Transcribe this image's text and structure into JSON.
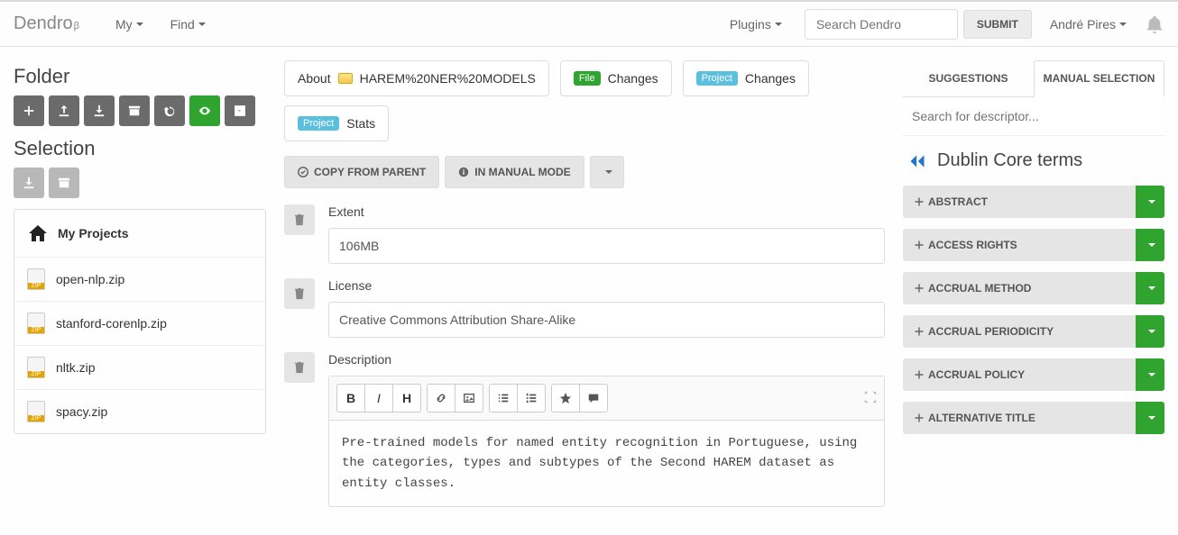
{
  "brand": {
    "name": "Dendro",
    "sup": "β"
  },
  "nav": {
    "my": "My",
    "find": "Find",
    "plugins": "Plugins",
    "search_placeholder": "Search Dendro",
    "submit": "SUBMIT",
    "user": "André Pires"
  },
  "left": {
    "folder_heading": "Folder",
    "selection_heading": "Selection",
    "projects_title": "My Projects",
    "files": [
      {
        "name": "open-nlp.zip"
      },
      {
        "name": "stanford-corenlp.zip"
      },
      {
        "name": "nltk.zip"
      },
      {
        "name": "spacy.zip"
      }
    ]
  },
  "center": {
    "tabs": {
      "about_label": "About",
      "about_path": "HAREM%20NER%20MODELS",
      "file_badge": "File",
      "file_changes": "Changes",
      "project_badge": "Project",
      "project_changes": "Changes",
      "project_stats_badge": "Project",
      "stats": "Stats"
    },
    "actions": {
      "copy_from_parent": "COPY FROM PARENT",
      "manual_mode": "IN MANUAL MODE"
    },
    "meta": {
      "extent": {
        "label": "Extent",
        "value": "106MB"
      },
      "license": {
        "label": "License",
        "value": "Creative Commons Attribution Share-Alike"
      },
      "description": {
        "label": "Description",
        "text": "Pre-trained models for named entity recognition in Portuguese, using the categories, types and subtypes of the Second HAREM dataset as entity classes."
      }
    }
  },
  "right": {
    "suggestions_tab": "SUGGESTIONS",
    "manual_tab": "MANUAL SELECTION",
    "search_placeholder": "Search for descriptor...",
    "terms_heading": "Dublin Core terms",
    "terms": [
      {
        "label": "ABSTRACT"
      },
      {
        "label": "ACCESS RIGHTS"
      },
      {
        "label": "ACCRUAL METHOD"
      },
      {
        "label": "ACCRUAL PERIODICITY"
      },
      {
        "label": "ACCRUAL POLICY"
      },
      {
        "label": "ALTERNATIVE TITLE"
      }
    ]
  }
}
